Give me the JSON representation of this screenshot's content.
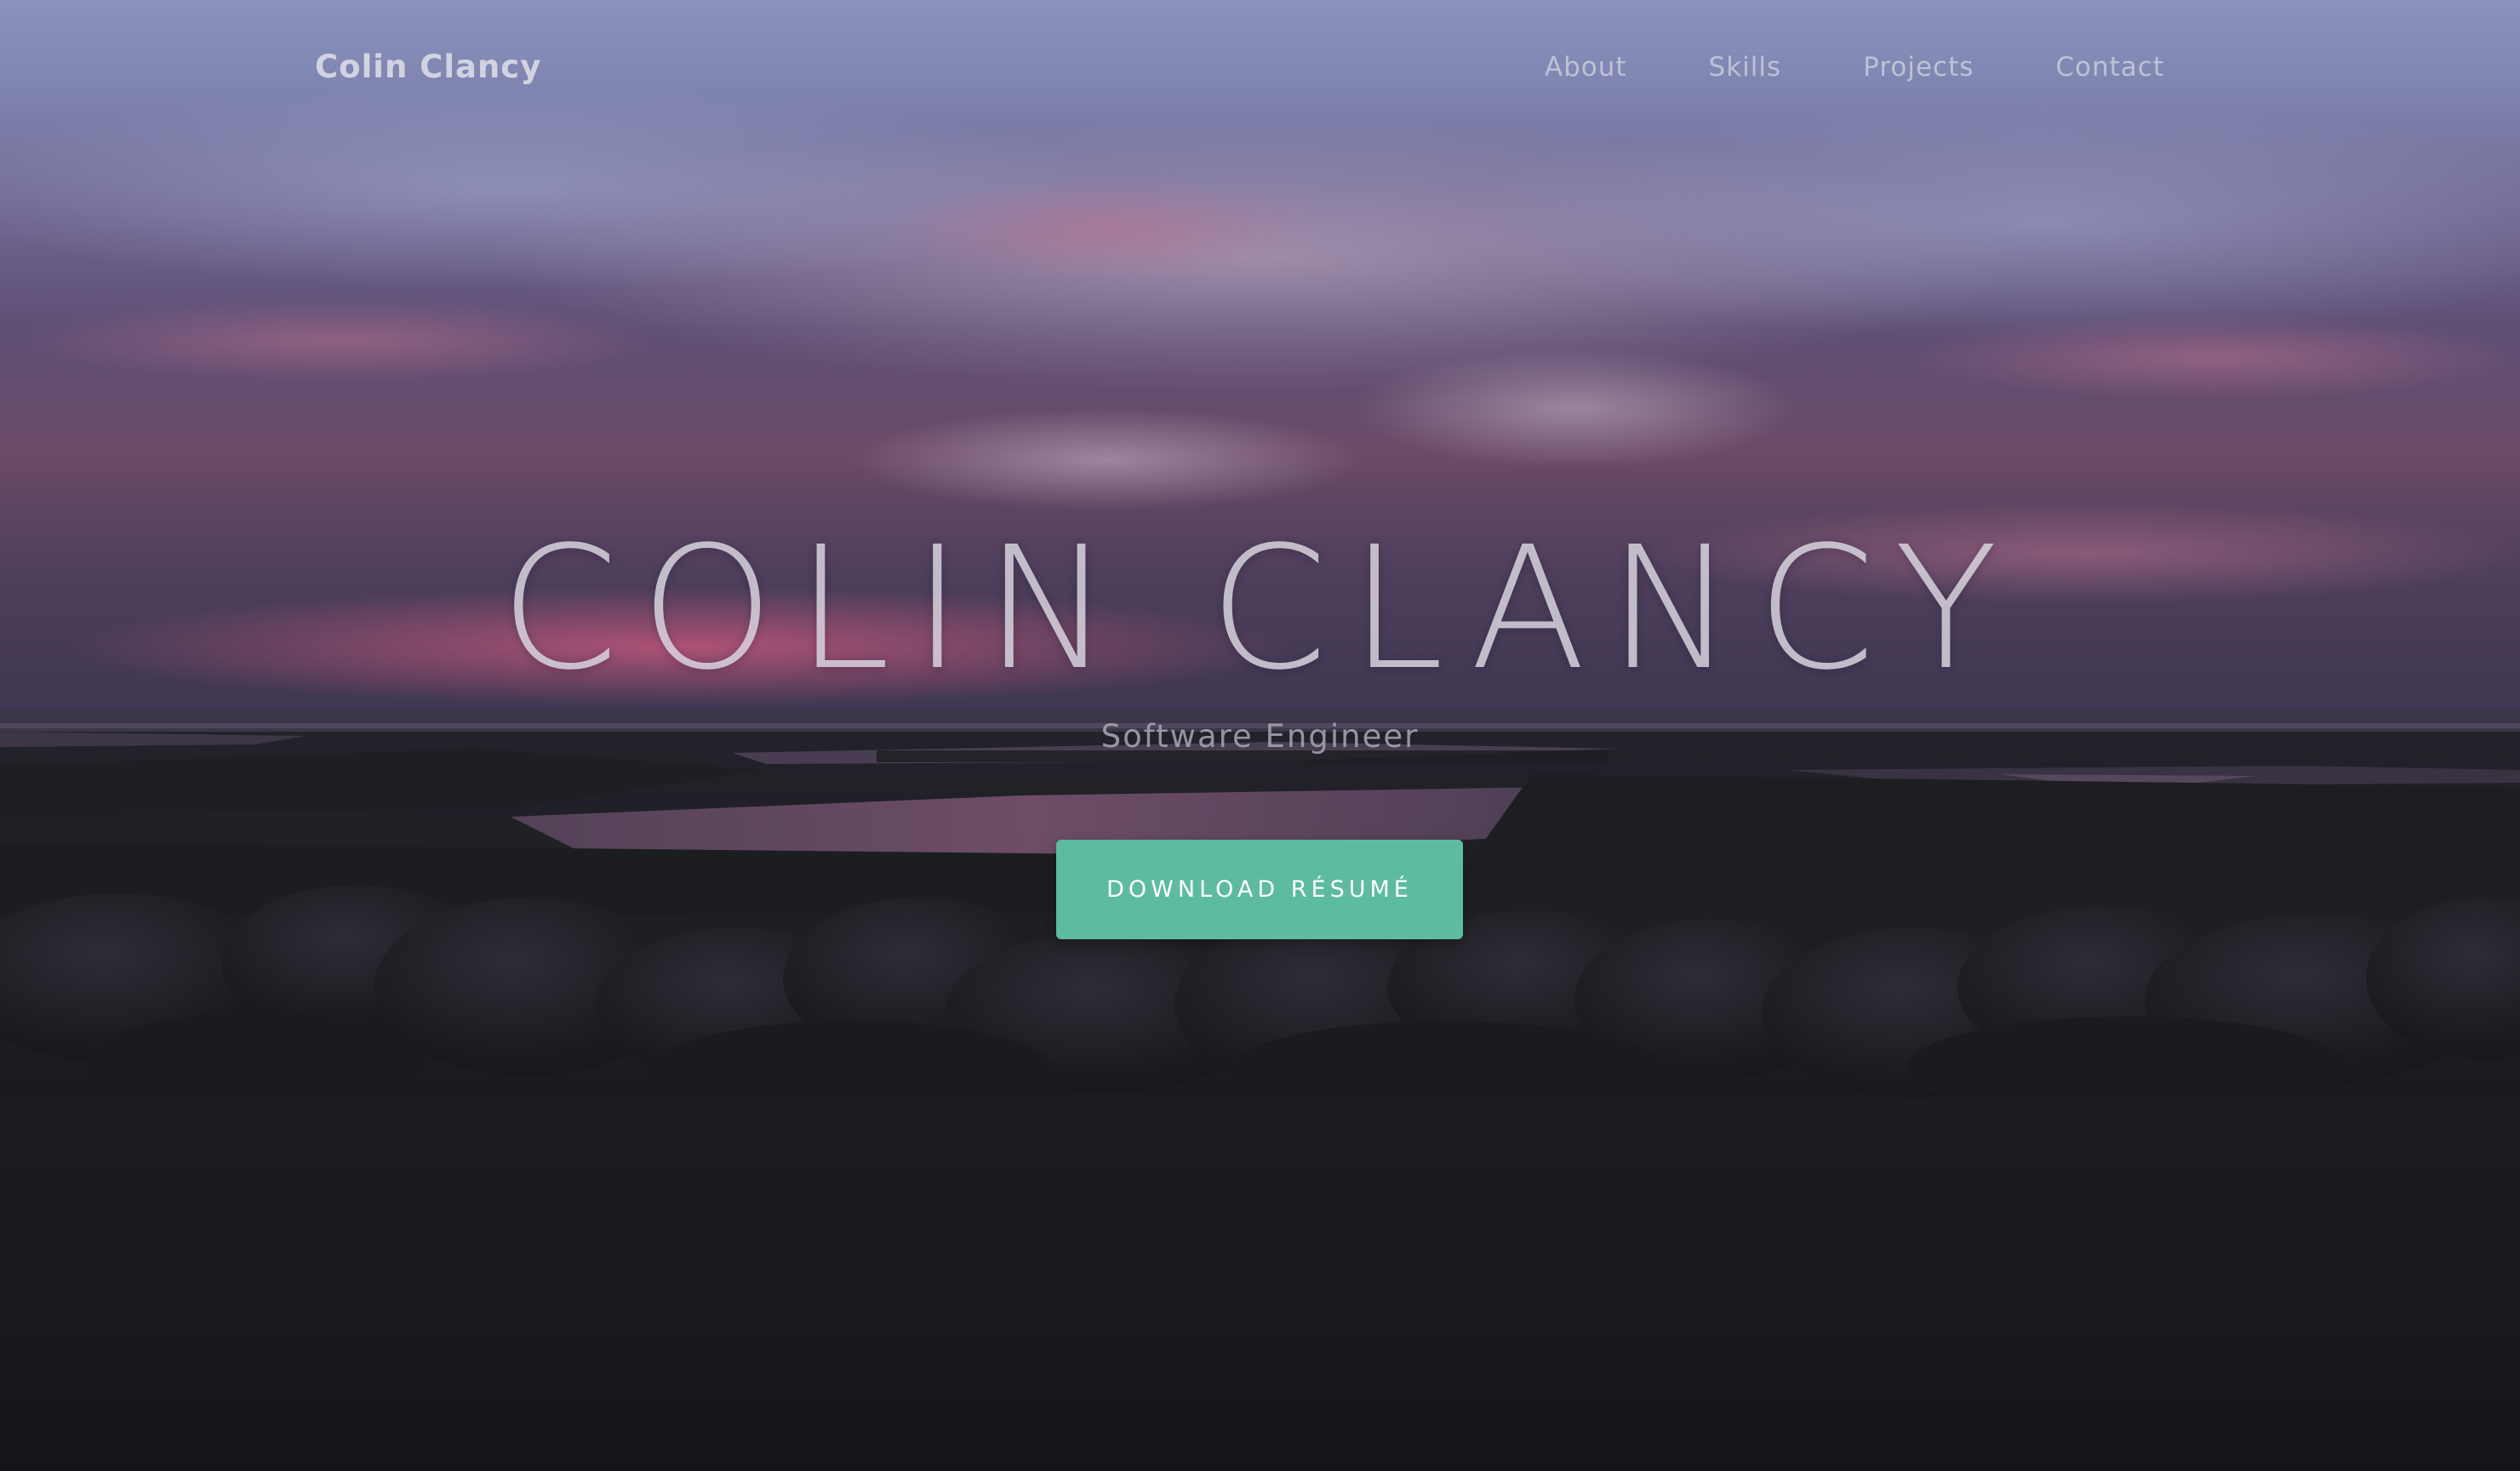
{
  "navbar": {
    "brand": "Colin Clancy",
    "links": [
      {
        "label": "About"
      },
      {
        "label": "Skills"
      },
      {
        "label": "Projects"
      },
      {
        "label": "Contact"
      }
    ]
  },
  "hero": {
    "title": "COLIN CLANCY",
    "subtitle": "Software Engineer",
    "cta_label": "DOWNLOAD RÉSUMÉ",
    "background": "sunset-over-marsh-and-rocks-photo"
  },
  "colors": {
    "accent_button": "#5dbba1",
    "sky_top": "#8a93bd",
    "sky_pink": "#b26a8e",
    "ground_dark": "#15161a"
  }
}
